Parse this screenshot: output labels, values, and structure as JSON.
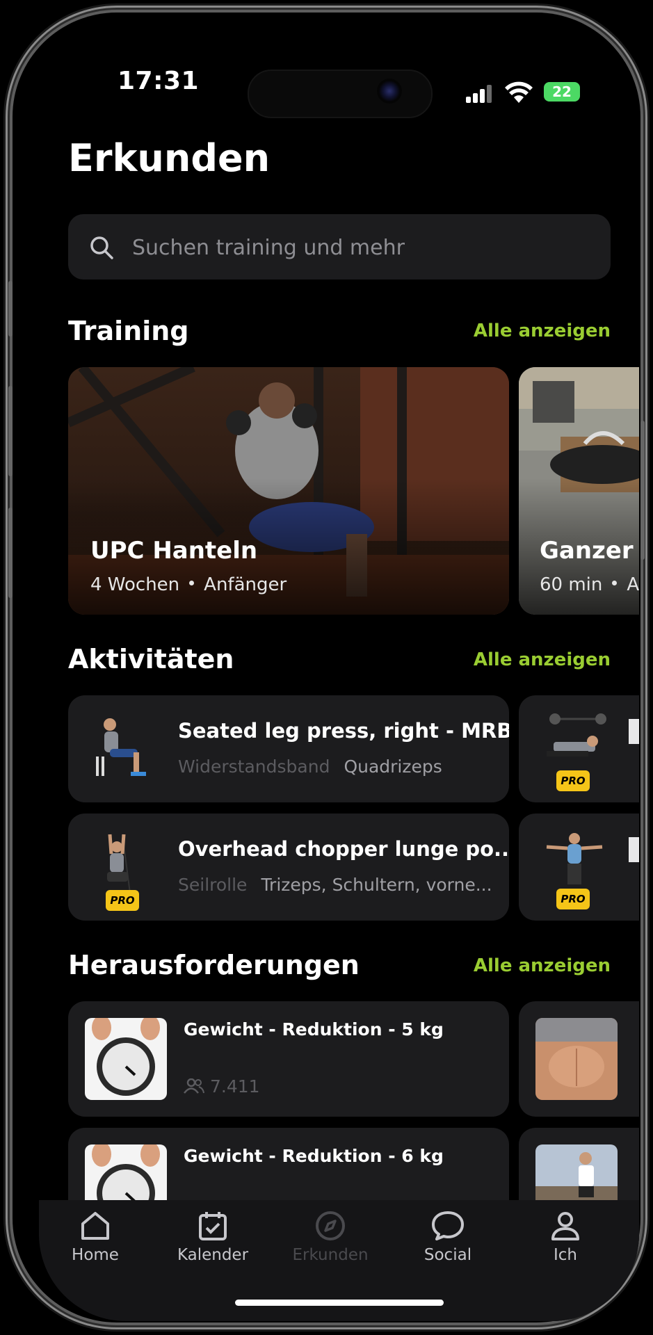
{
  "status_bar": {
    "time": "17:31",
    "battery": "22"
  },
  "page_title": "Erkunden",
  "search": {
    "placeholder": "Suchen training und mehr"
  },
  "sections": {
    "training": {
      "title": "Training",
      "see_all": "Alle anzeigen",
      "cards": [
        {
          "title": "UPC Hanteln",
          "duration": "4 Wochen",
          "level": "Anfänger"
        },
        {
          "title": "Ganzer",
          "duration": "60 min",
          "level": "A"
        }
      ]
    },
    "activities": {
      "title": "Aktivitäten",
      "see_all": "Alle anzeigen",
      "items": [
        {
          "title": "Seated leg press, right - MRB",
          "equipment": "Widerstandsband",
          "muscle": "Quadrizeps",
          "pro": false
        },
        {
          "title": "Overhead chopper lunge po...",
          "equipment": "Seilrolle",
          "muscle": "Trizeps, Schultern, vorne...",
          "pro": true
        }
      ],
      "pro_label": "PRO"
    },
    "challenges": {
      "title": "Herausforderungen",
      "see_all": "Alle anzeigen",
      "items": [
        {
          "title": "Gewicht - Reduktion - 5 kg",
          "participants": "7.411"
        },
        {
          "title": "Gewicht - Reduktion - 6 kg",
          "participants": ""
        }
      ]
    }
  },
  "tabbar": {
    "items": [
      {
        "label": "Home",
        "icon": "home-icon"
      },
      {
        "label": "Kalender",
        "icon": "calendar-icon"
      },
      {
        "label": "Erkunden",
        "icon": "compass-icon",
        "active": true
      },
      {
        "label": "Social",
        "icon": "chat-bubble-icon"
      },
      {
        "label": "Ich",
        "icon": "person-icon"
      }
    ]
  },
  "colors": {
    "accent": "#9acd32",
    "pro_badge": "#f5c518",
    "card_bg": "#1c1c1e",
    "battery": "#4cd964"
  }
}
